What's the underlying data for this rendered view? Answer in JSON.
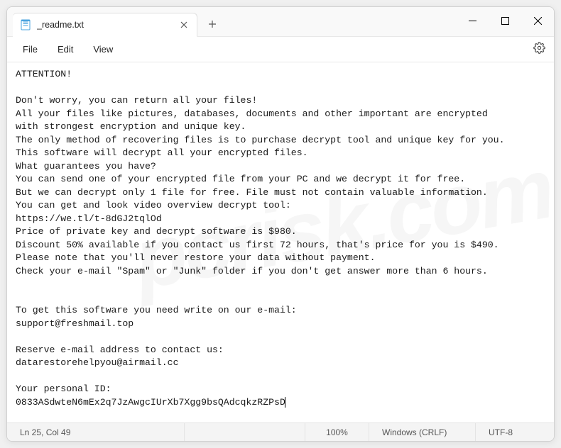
{
  "tab": {
    "title": "_readme.txt",
    "icon": "notepad-icon"
  },
  "menu": {
    "file": "File",
    "edit": "Edit",
    "view": "View"
  },
  "document": {
    "body": "ATTENTION!\n\nDon't worry, you can return all your files!\nAll your files like pictures, databases, documents and other important are encrypted\nwith strongest encryption and unique key.\nThe only method of recovering files is to purchase decrypt tool and unique key for you.\nThis software will decrypt all your encrypted files.\nWhat guarantees you have?\nYou can send one of your encrypted file from your PC and we decrypt it for free.\nBut we can decrypt only 1 file for free. File must not contain valuable information.\nYou can get and look video overview decrypt tool:\nhttps://we.tl/t-8dGJ2tqlOd\nPrice of private key and decrypt software is $980.\nDiscount 50% available if you contact us first 72 hours, that's price for you is $490.\nPlease note that you'll never restore your data without payment.\nCheck your e-mail \"Spam\" or \"Junk\" folder if you don't get answer more than 6 hours.\n\n\nTo get this software you need write on our e-mail:\nsupport@freshmail.top\n\nReserve e-mail address to contact us:\ndatarestorehelpyou@airmail.cc\n\nYour personal ID:\n0833ASdwteN6mEx2q7JzAwgcIUrXb7Xgg9bsQAdcqkzRZPsD"
  },
  "status": {
    "position": "Ln 25, Col 49",
    "zoom": "100%",
    "line_ending": "Windows (CRLF)",
    "encoding": "UTF-8"
  },
  "watermark": "pcrisk.com"
}
